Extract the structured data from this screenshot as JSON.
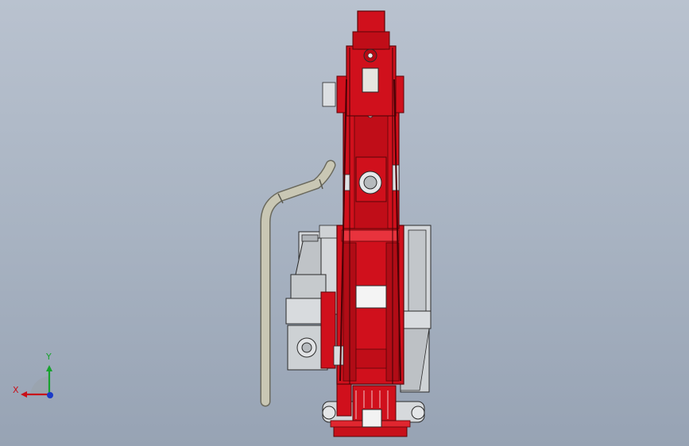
{
  "viewport": {
    "background_top": "#b9c2cf",
    "background_bottom": "#97a3b4"
  },
  "model": {
    "colors": {
      "arm": "#d0101c",
      "arm_dark": "#8a0a12",
      "arm_light": "#e8333d",
      "casing": "#d4d7da",
      "casing_shadow": "#9ea3a8",
      "cable": "#c9c7b4",
      "outline": "#2a2a2a"
    }
  },
  "triad": {
    "x_label": "X",
    "y_label": "Y",
    "x_color": "#c8101a",
    "y_color": "#17a32d",
    "z_color": "#1a3ac8",
    "icons": [
      "axis-x-arrow-icon",
      "axis-y-arrow-icon",
      "axis-z-origin-icon"
    ]
  }
}
